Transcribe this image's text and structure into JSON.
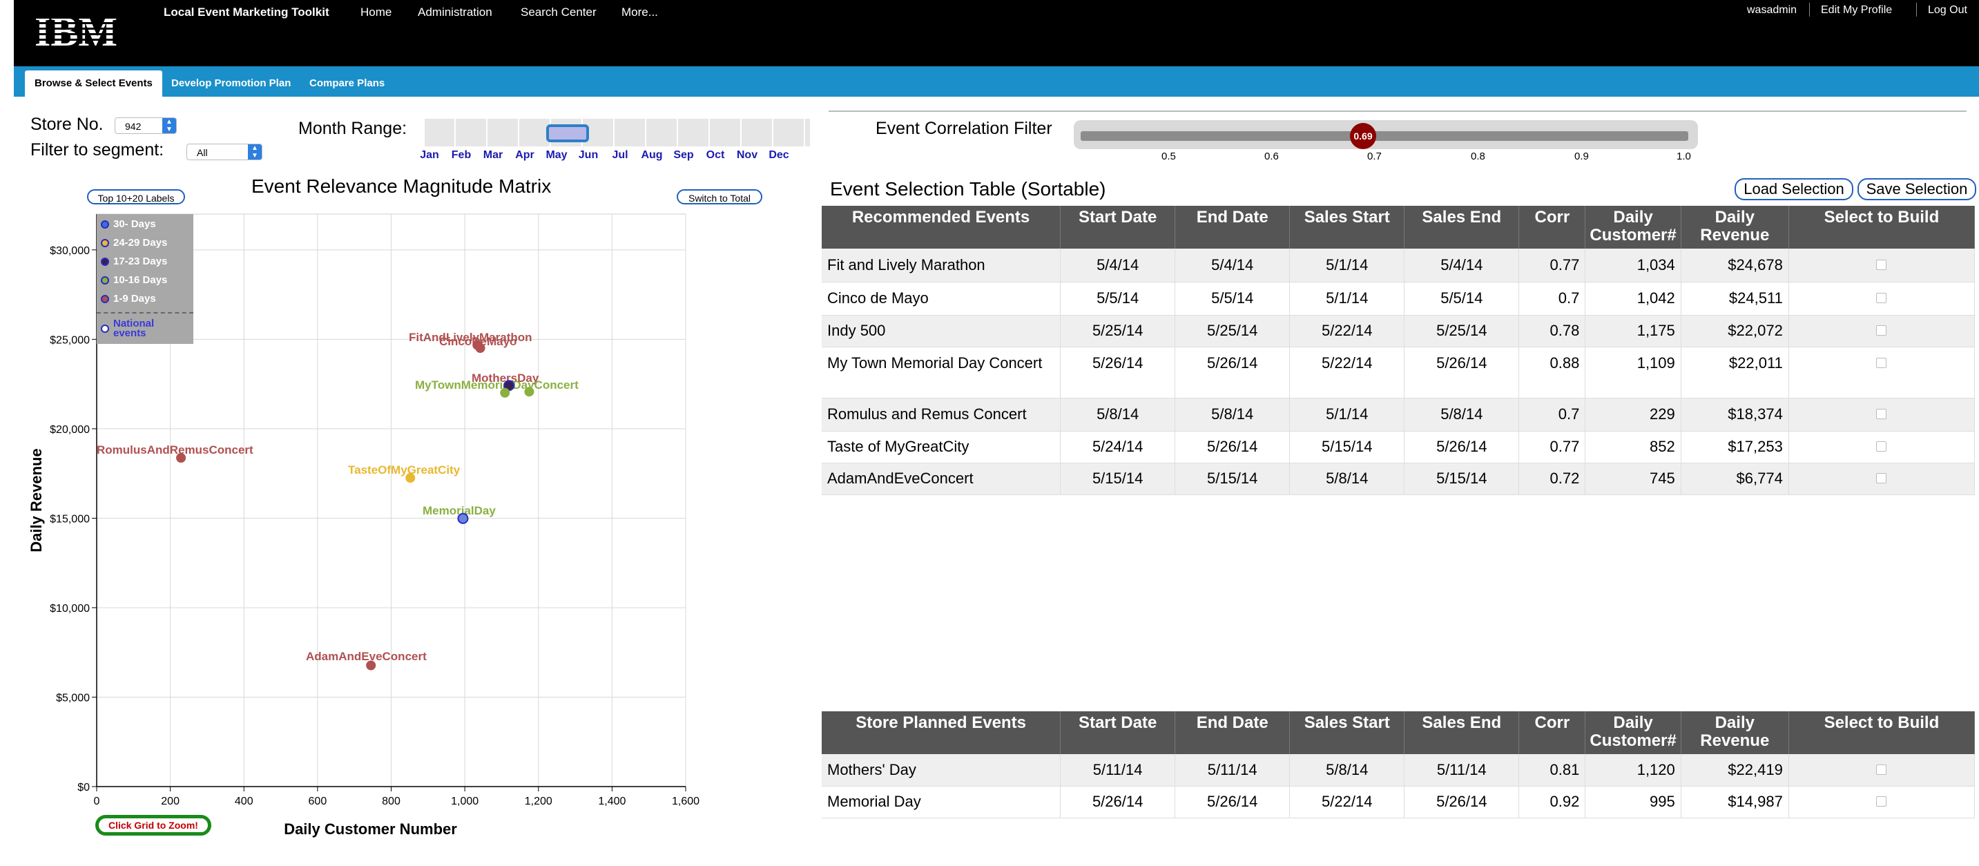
{
  "header": {
    "logo_text": "IBM",
    "app_title": "Local Event Marketing Toolkit",
    "nav": [
      "Home",
      "Administration",
      "Search Center",
      "More..."
    ],
    "user_links": [
      "wasadmin",
      "Edit My Profile",
      "Log Out"
    ]
  },
  "tabs": [
    "Browse & Select Events",
    "Develop Promotion Plan",
    "Compare Plans"
  ],
  "controls": {
    "store_label": "Store No.",
    "store_value": "942",
    "segment_label": "Filter to segment:",
    "segment_value": "All",
    "month_label": "Month Range:",
    "months": [
      "Jan",
      "Feb",
      "Mar",
      "Apr",
      "May",
      "Jun",
      "Jul",
      "Aug",
      "Sep",
      "Oct",
      "Nov",
      "Dec"
    ],
    "corr_label": "Event Correlation Filter",
    "corr_value": "0.69",
    "corr_ticks": [
      "0.5",
      "0.6",
      "0.7",
      "0.8",
      "0.9",
      "1.0"
    ]
  },
  "chart_data": {
    "type": "scatter",
    "title": "Event Relevance Magnitude Matrix",
    "xlabel": "Daily Customer Number",
    "ylabel": "Daily Revenue",
    "xlim": [
      0,
      1600
    ],
    "ylim": [
      0,
      32000
    ],
    "x_ticks": [
      "0",
      "200",
      "400",
      "600",
      "800",
      "1,000",
      "1,200",
      "1,400",
      "1,600"
    ],
    "y_ticks": [
      "$0",
      "$5,000",
      "$10,000",
      "$15,000",
      "$20,000",
      "$25,000",
      "$30,000"
    ],
    "grid": true,
    "legend_placement": "top-left",
    "legend": [
      {
        "label": "30- Days",
        "color": "#3a6fd8"
      },
      {
        "label": "24-29 Days",
        "color": "#e8b830"
      },
      {
        "label": "17-23 Days",
        "color": "#3a2050"
      },
      {
        "label": "10-16 Days",
        "color": "#8ab040"
      },
      {
        "label": "1-9 Days",
        "color": "#b05050"
      },
      {
        "label": "National events",
        "color": "#3a3ad8"
      }
    ],
    "points": [
      {
        "label": "FitAndLivelyMarathon",
        "x": 1034,
        "y": 24678,
        "color": "#b05050"
      },
      {
        "label": "CincoDeMayo",
        "x": 1042,
        "y": 24511,
        "color": "#b05050"
      },
      {
        "label": "MothersDay",
        "x": 1120,
        "y": 22419,
        "color": "#3a2050"
      },
      {
        "label": "MyTownMemorialDayConcert",
        "x": 1109,
        "y": 22011,
        "color": "#8ab040"
      },
      {
        "label": "Indy500",
        "x": 1175,
        "y": 22072,
        "color": "#8ab040"
      },
      {
        "label": "RomulusAndRemusConcert",
        "x": 229,
        "y": 18374,
        "color": "#b05050"
      },
      {
        "label": "TasteOfMyGreatCity",
        "x": 852,
        "y": 17253,
        "color": "#e8b830"
      },
      {
        "label": "MemorialDay",
        "x": 995,
        "y": 14987,
        "color": "#6a86e0"
      },
      {
        "label": "AdamAndEveConcert",
        "x": 745,
        "y": 6774,
        "color": "#b05050"
      }
    ],
    "point_text": [
      {
        "text": "FitAndLivelyMarathon",
        "color": "#b05050"
      },
      {
        "text": "CincoDeMayo",
        "color": "#b05050"
      },
      {
        "text": "MothersDay",
        "color": "#b05050"
      },
      {
        "text": "MyTownMemorialDayConcert",
        "color": "#8ab040"
      },
      {
        "text": "RomulusAndRemusConcert",
        "color": "#b05050"
      },
      {
        "text": "TasteOfMyGreatCity",
        "color": "#e8b830"
      },
      {
        "text": "MemorialDay",
        "color": "#8ab040"
      },
      {
        "text": "AdamAndEveConcert",
        "color": "#b05050"
      }
    ]
  },
  "chart_buttons": {
    "top_labels": "Top 10+20 Labels",
    "switch_total": "Switch to Total",
    "zoom": "Click Grid to Zoom!"
  },
  "selection_table": {
    "title": "Event Selection Table (Sortable)",
    "load_button": "Load Selection",
    "save_button": "Save Selection",
    "headers": [
      "Recommended Events",
      "Start Date",
      "End Date",
      "Sales Start",
      "Sales End",
      "Corr",
      "Daily Customer#",
      "Daily Revenue",
      "Select to Build"
    ],
    "rows": [
      [
        "Fit and Lively Marathon",
        "5/4/14",
        "5/4/14",
        "5/1/14",
        "5/4/14",
        "0.77",
        "1,034",
        "$24,678"
      ],
      [
        "Cinco de Mayo",
        "5/5/14",
        "5/5/14",
        "5/1/14",
        "5/5/14",
        "0.7",
        "1,042",
        "$24,511"
      ],
      [
        "Indy 500",
        "5/25/14",
        "5/25/14",
        "5/22/14",
        "5/25/14",
        "0.78",
        "1,175",
        "$22,072"
      ],
      [
        "My Town Memorial Day Concert",
        "5/26/14",
        "5/26/14",
        "5/22/14",
        "5/26/14",
        "0.88",
        "1,109",
        "$22,011"
      ],
      [
        "Romulus and Remus Concert",
        "5/8/14",
        "5/8/14",
        "5/1/14",
        "5/8/14",
        "0.7",
        "229",
        "$18,374"
      ],
      [
        "Taste of MyGreatCity",
        "5/24/14",
        "5/26/14",
        "5/15/14",
        "5/26/14",
        "0.77",
        "852",
        "$17,253"
      ],
      [
        "AdamAndEveConcert",
        "5/15/14",
        "5/15/14",
        "5/8/14",
        "5/15/14",
        "0.72",
        "745",
        "$6,774"
      ]
    ]
  },
  "planned_table": {
    "headers": [
      "Store Planned Events",
      "Start Date",
      "End Date",
      "Sales Start",
      "Sales End",
      "Corr",
      "Daily Customer#",
      "Daily Revenue",
      "Select to Build"
    ],
    "rows": [
      [
        "Mothers' Day",
        "5/11/14",
        "5/11/14",
        "5/8/14",
        "5/11/14",
        "0.81",
        "1,120",
        "$22,419"
      ],
      [
        "Memorial Day",
        "5/26/14",
        "5/26/14",
        "5/22/14",
        "5/26/14",
        "0.92",
        "995",
        "$14,987"
      ]
    ]
  }
}
